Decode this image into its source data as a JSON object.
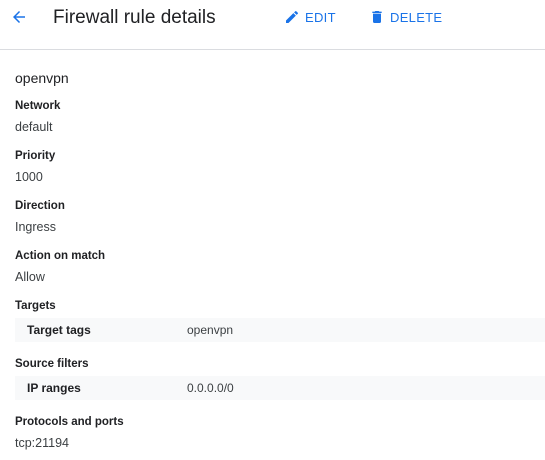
{
  "header": {
    "title": "Firewall rule details",
    "edit_label": "EDIT",
    "delete_label": "DELETE",
    "accent_color": "#1a73e8"
  },
  "rule": {
    "name": "openvpn",
    "network": {
      "label": "Network",
      "value": "default"
    },
    "priority": {
      "label": "Priority",
      "value": "1000"
    },
    "direction": {
      "label": "Direction",
      "value": "Ingress"
    },
    "action": {
      "label": "Action on match",
      "value": "Allow"
    },
    "targets": {
      "label": "Targets",
      "key": "Target tags",
      "value": "openvpn"
    },
    "source_filters": {
      "label": "Source filters",
      "key": "IP ranges",
      "value": "0.0.0.0/0"
    },
    "protocols": {
      "label": "Protocols and ports",
      "value": "tcp:21194"
    }
  },
  "icons": {
    "back": "arrow-back-icon",
    "edit": "pencil-icon",
    "delete": "trash-icon"
  }
}
